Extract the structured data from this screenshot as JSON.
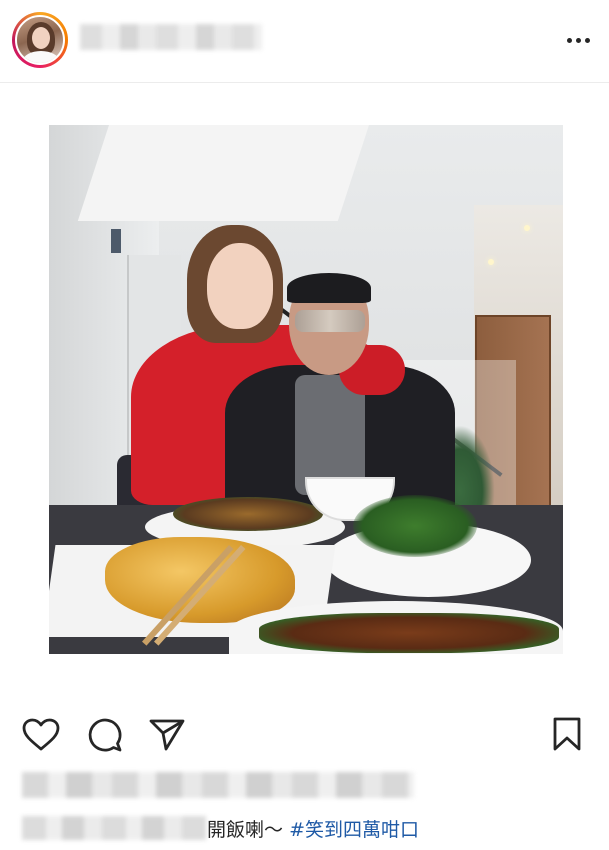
{
  "post": {
    "caption": "開飯喇～",
    "hashtag": "#笑到四萬咁口"
  },
  "icons": {
    "more": "more-options-icon",
    "like": "heart-icon",
    "comment": "comment-icon",
    "share": "send-icon",
    "save": "bookmark-icon"
  }
}
